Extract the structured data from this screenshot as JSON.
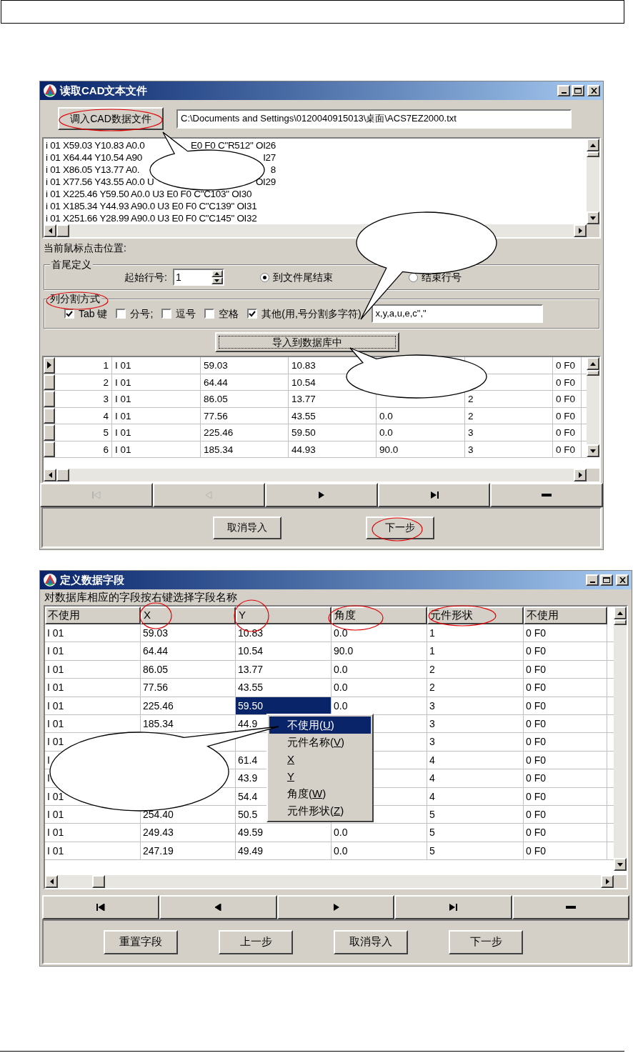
{
  "import_window": {
    "title": "读取CAD文本文件",
    "load_button": "调入CAD数据文件",
    "file_path": "C:\\Documents and Settings\\0120040915013\\桌面\\ACS7EZ2000.txt",
    "listing": [
      {
        "text": "i 01 X59.03 Y10.83 A0.0",
        "tail": "E0 F0 C\"R512\" OI26"
      },
      {
        "text": "i 01 X64.44 Y10.54 A90",
        "tail": "I27"
      },
      {
        "text": "i 01 X86.05 Y13.77 A0.",
        "tail": "8"
      },
      {
        "text": "i 01 X77.56 Y43.55 A0.0 U",
        "tail": "OI29"
      },
      {
        "text": "i 01 X225.46 Y59.50 A0.0 U3 E0 F0 C\"C103\" OI30"
      },
      {
        "text": "i 01 X185.34 Y44.93 A90.0 U3 E0 F0 C\"C139\" OI31"
      },
      {
        "text": "i 01 X251.66 Y28.99 A90.0 U3 E0 F0 C\"C145\" OI32"
      }
    ],
    "cursor_label": "当前鼠标点击位置:",
    "range_group": {
      "title": "首尾定义",
      "start_label": "起始行号:",
      "start_value": "1",
      "options": [
        {
          "label": "到文件尾结束",
          "selected": true
        },
        {
          "label": "结束行号",
          "selected": false
        }
      ]
    },
    "split_group": {
      "title": "列分割方式",
      "options": [
        {
          "label": "Tab 键",
          "checked": true
        },
        {
          "label": "分号;",
          "checked": false
        },
        {
          "label": "逗号",
          "checked": false
        },
        {
          "label": "空格",
          "checked": false
        },
        {
          "label": "其他(用,号分割多字符)",
          "checked": true
        }
      ],
      "other_value": "x,y,a,u,e,c\",\""
    },
    "import_button": "导入到数据库中",
    "grid_rows": [
      {
        "current": true,
        "cells": [
          "1",
          "I 01",
          "59.03",
          "10.83",
          null,
          null,
          "0 F0"
        ]
      },
      {
        "current": false,
        "cells": [
          "2",
          "I 01",
          "64.44",
          "10.54",
          null,
          null,
          "0 F0"
        ]
      },
      {
        "current": false,
        "cells": [
          "3",
          "I 01",
          "86.05",
          "13.77",
          null,
          "2",
          "0 F0"
        ]
      },
      {
        "current": false,
        "cells": [
          "4",
          "I 01",
          "77.56",
          "43.55",
          "0.0",
          "2",
          "0 F0"
        ]
      },
      {
        "current": false,
        "cells": [
          "5",
          "I 01",
          "225.46",
          "59.50",
          "0.0",
          "3",
          "0 F0"
        ]
      },
      {
        "current": false,
        "cells": [
          "6",
          "I 01",
          "185.34",
          "44.93",
          "90.0",
          "3",
          "0 F0"
        ]
      }
    ],
    "navigator": [
      {
        "kind": "first",
        "disabled": true
      },
      {
        "kind": "prior",
        "disabled": true
      },
      {
        "kind": "next",
        "disabled": false
      },
      {
        "kind": "last",
        "disabled": false
      },
      {
        "kind": "delete",
        "disabled": false
      }
    ],
    "buttons": [
      "取消导入",
      "下一步"
    ]
  },
  "fields_window": {
    "title": "定义数据字段",
    "hint": "对数据库相应的字段按右键选择字段名称",
    "columns": [
      "不使用",
      "X",
      "Y",
      "角度",
      "元件形状",
      "不使用"
    ],
    "rows": [
      {
        "cells": [
          "I 01",
          "59.03",
          "10.83",
          "0.0",
          "1",
          "0 F0"
        ],
        "selected": [
          false,
          false,
          false,
          false,
          false,
          false
        ]
      },
      {
        "cells": [
          "I 01",
          "64.44",
          "10.54",
          "90.0",
          "1",
          "0 F0"
        ],
        "selected": [
          false,
          false,
          false,
          false,
          false,
          false
        ]
      },
      {
        "cells": [
          "I 01",
          "86.05",
          "13.77",
          "0.0",
          "2",
          "0 F0"
        ],
        "selected": [
          false,
          false,
          false,
          false,
          false,
          false
        ]
      },
      {
        "cells": [
          "I 01",
          "77.56",
          "43.55",
          "0.0",
          "2",
          "0 F0"
        ],
        "selected": [
          false,
          false,
          false,
          false,
          false,
          false
        ]
      },
      {
        "cells": [
          "I 01",
          "225.46",
          "59.50",
          "0.0",
          "3",
          "0 F0"
        ],
        "selected": [
          false,
          false,
          true,
          false,
          false,
          false
        ]
      },
      {
        "cells": [
          "I 01",
          "185.34",
          "44.9",
          null,
          "3",
          "0 F0"
        ],
        "selected": [
          false,
          false,
          false,
          false,
          false,
          false
        ]
      },
      {
        "cells": [
          "I 01",
          null,
          null,
          null,
          "3",
          "0 F0"
        ],
        "selected": [
          false,
          false,
          false,
          false,
          false,
          false
        ]
      },
      {
        "cells": [
          "I",
          null,
          "61.4",
          null,
          "4",
          "0 F0"
        ],
        "selected": [
          false,
          false,
          false,
          false,
          false,
          false
        ]
      },
      {
        "cells": [
          "I",
          null,
          "43.9",
          null,
          "4",
          "0 F0"
        ],
        "selected": [
          false,
          false,
          false,
          false,
          false,
          false
        ]
      },
      {
        "cells": [
          "I 01",
          null,
          "54.4",
          null,
          "4",
          "0 F0"
        ],
        "selected": [
          false,
          false,
          false,
          false,
          false,
          false
        ]
      },
      {
        "cells": [
          "I 01",
          "254.40",
          "50.5",
          null,
          "5",
          "0 F0"
        ],
        "selected": [
          false,
          false,
          false,
          false,
          false,
          false
        ]
      },
      {
        "cells": [
          "I 01",
          "249.43",
          "49.59",
          "0.0",
          "5",
          "0 F0"
        ],
        "selected": [
          false,
          false,
          false,
          false,
          false,
          false
        ]
      },
      {
        "cells": [
          "I 01",
          "247.19",
          "49.49",
          "0.0",
          "5",
          "0 F0"
        ],
        "selected": [
          false,
          false,
          false,
          false,
          false,
          false
        ]
      }
    ],
    "context_menu": [
      {
        "prefix": "不使用(",
        "key": "U",
        "suffix": ")",
        "selected": true
      },
      {
        "prefix": "元件名称(",
        "key": "V",
        "suffix": ")",
        "selected": false
      },
      {
        "key": "X",
        "selected": false
      },
      {
        "key": "Y",
        "selected": false
      },
      {
        "prefix": "角度(",
        "key": "W",
        "suffix": ")",
        "selected": false
      },
      {
        "prefix": "元件形状(",
        "key": "Z",
        "suffix": ")",
        "selected": false
      }
    ],
    "navigator": [
      {
        "kind": "first",
        "disabled": false
      },
      {
        "kind": "prior",
        "disabled": false
      },
      {
        "kind": "next",
        "disabled": false
      },
      {
        "kind": "last",
        "disabled": false
      },
      {
        "kind": "delete",
        "disabled": false
      }
    ],
    "buttons": [
      "重置字段",
      "上一步",
      "取消导入",
      "下一步"
    ]
  }
}
